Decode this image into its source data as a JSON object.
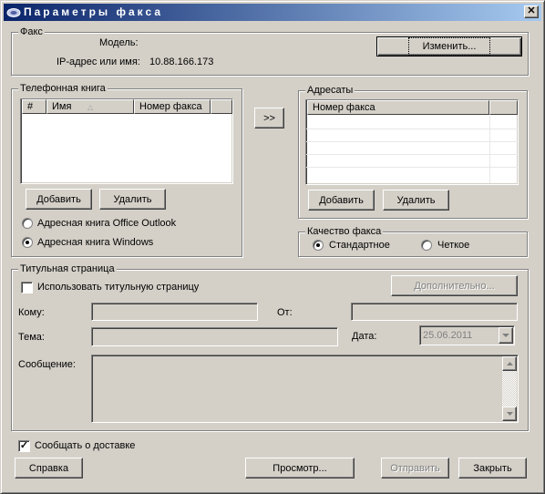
{
  "window": {
    "title": "Параметры факса",
    "close_glyph": "✕"
  },
  "fax": {
    "group_label": "Факс",
    "model_label": "Модель:",
    "model_value": "",
    "ip_label": "IP-адрес или имя:",
    "ip_value": "10.88.166.173",
    "change_button": "Изменить..."
  },
  "phonebook": {
    "group_label": "Телефонная книга",
    "columns": [
      "#",
      "Имя",
      "Номер факса"
    ],
    "add_button": "Добавить",
    "delete_button": "Удалить",
    "source_outlook": "Адресная книга Office Outlook",
    "source_windows": "Адресная книга Windows",
    "selected_source": "windows"
  },
  "move_button": ">>",
  "recipients": {
    "group_label": "Адресаты",
    "columns": [
      "Номер факса",
      ""
    ],
    "add_button": "Добавить",
    "delete_button": "Удалить"
  },
  "quality": {
    "group_label": "Качество факса",
    "standard": "Стандартное",
    "fine": "Четкое",
    "selected": "standard"
  },
  "cover": {
    "group_label": "Титульная страница",
    "use_cover": "Использовать титульную страницу",
    "use_cover_checked": false,
    "advanced_button": "Дополнительно...",
    "to_label": "Кому:",
    "from_label": "От:",
    "subject_label": "Тема:",
    "date_label": "Дата:",
    "date_value": "25.06.2011",
    "message_label": "Сообщение:"
  },
  "notify_delivery": {
    "label": "Сообщать о доставке",
    "checked": true
  },
  "buttons": {
    "help": "Справка",
    "preview": "Просмотр...",
    "send": "Отправить",
    "close": "Закрыть"
  },
  "icons": {
    "app": "fax-app-icon",
    "close": "close-icon",
    "dropdown": "chevron-down-icon",
    "scroll_up": "arrow-up-icon",
    "scroll_down": "arrow-down-icon",
    "sort": "sort-icon"
  }
}
